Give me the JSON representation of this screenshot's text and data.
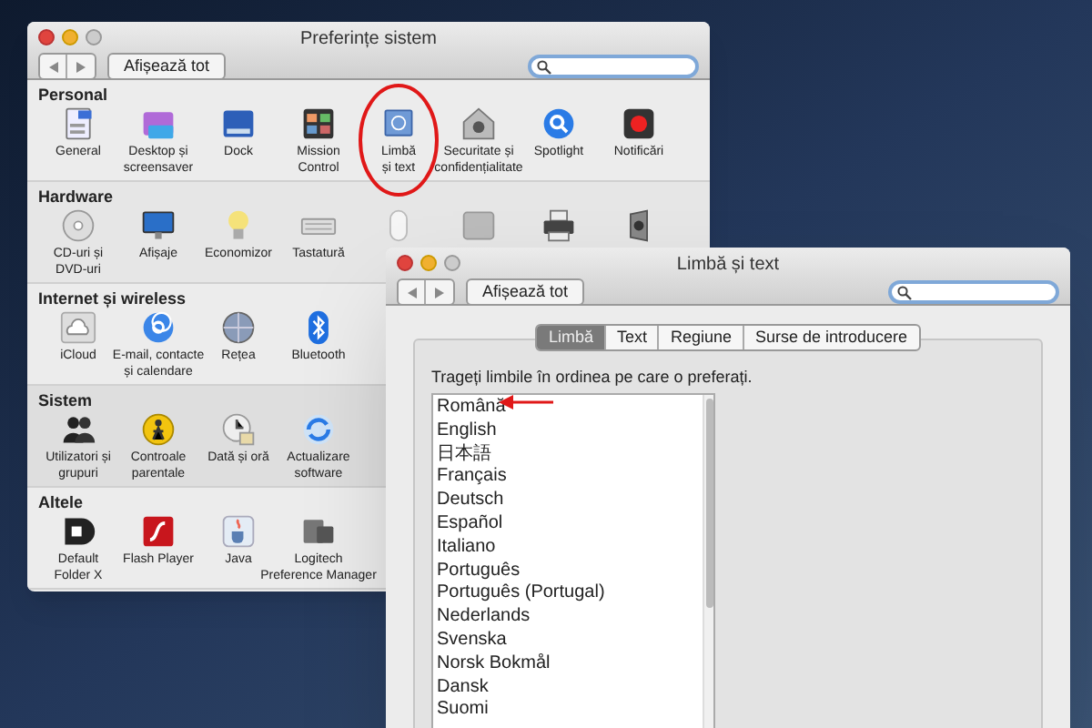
{
  "preferences_window": {
    "title": "Preferințe sistem",
    "show_all_button": "Afișează tot",
    "sections": [
      {
        "title": "Personal",
        "items": [
          {
            "label": "General"
          },
          {
            "label": "Desktop și\nscreensaver"
          },
          {
            "label": "Dock"
          },
          {
            "label": "Mission\nControl"
          },
          {
            "label": "Limbă\nși text"
          },
          {
            "label": "Securitate și\nconfidențialitate"
          },
          {
            "label": "Spotlight"
          },
          {
            "label": "Notificări"
          }
        ]
      },
      {
        "title": "Hardware",
        "items": [
          {
            "label": "CD-uri și\nDVD-uri"
          },
          {
            "label": "Afișaje"
          },
          {
            "label": "Economizor"
          },
          {
            "label": "Tastatură"
          }
        ]
      },
      {
        "title": "Internet și wireless",
        "items": [
          {
            "label": "iCloud"
          },
          {
            "label": "E-mail, contacte\nși calendare"
          },
          {
            "label": "Rețea"
          },
          {
            "label": "Bluetooth"
          }
        ]
      },
      {
        "title": "Sistem",
        "items": [
          {
            "label": "Utilizatori și\ngrupuri"
          },
          {
            "label": "Controale\nparentale"
          },
          {
            "label": "Dată și oră"
          },
          {
            "label": "Actualizare\nsoftware"
          }
        ]
      },
      {
        "title": "Altele",
        "items": [
          {
            "label": "Default\nFolder X"
          },
          {
            "label": "Flash Player"
          },
          {
            "label": "Java"
          },
          {
            "label": "Logitech\nPreference Manager"
          }
        ]
      }
    ]
  },
  "language_window": {
    "title": "Limbă și text",
    "show_all_button": "Afișează tot",
    "tabs": [
      {
        "label": "Limbă",
        "selected": true
      },
      {
        "label": "Text",
        "selected": false
      },
      {
        "label": "Regiune",
        "selected": false
      },
      {
        "label": "Surse de introducere",
        "selected": false
      }
    ],
    "instruction": "Trageți limbile în ordinea pe care o preferați.",
    "languages": [
      "Română",
      "English",
      "日本語",
      "Français",
      "Deutsch",
      "Español",
      "Italiano",
      "Português",
      "Português (Portugal)",
      "Nederlands",
      "Svenska",
      "Norsk Bokmål",
      "Dansk",
      "Suomi"
    ]
  }
}
